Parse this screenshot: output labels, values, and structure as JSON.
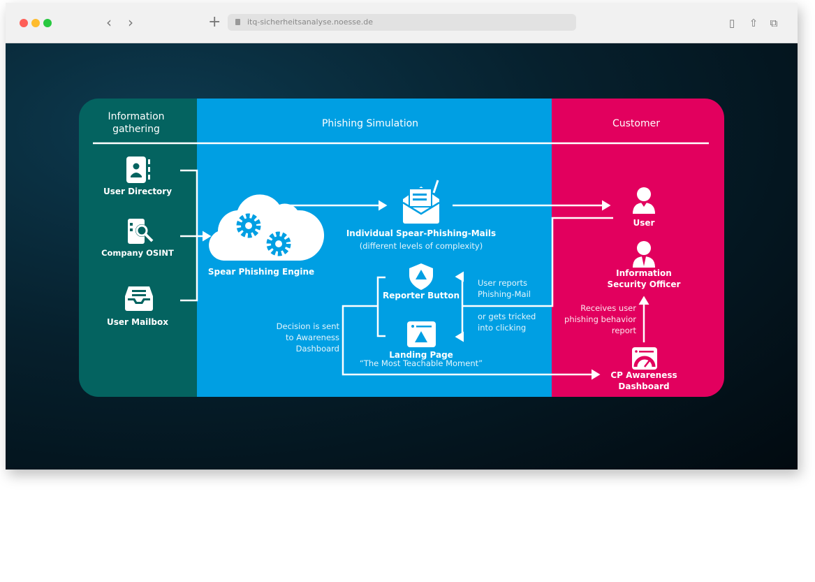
{
  "browser": {
    "url": "itq-sicherheitsanalyse.noesse.de",
    "controls": [
      "close",
      "minimize",
      "zoom"
    ],
    "icons": [
      "back-icon",
      "forward-icon",
      "new-tab-icon",
      "lock-icon",
      "reader-icon",
      "share-icon",
      "tabs-icon"
    ]
  },
  "colors": {
    "gathering": "#046360",
    "simulation": "#009fe3",
    "customer": "#e2005e"
  },
  "diagram": {
    "columns": {
      "gathering": "Information\ngathering",
      "gathering_l1": "Information",
      "gathering_l2": "gathering",
      "simulation": "Phishing Simulation",
      "customer": "Customer"
    },
    "sources": {
      "user_directory": "User Directory",
      "company_osint": "Company OSINT",
      "user_mailbox": "User Mailbox"
    },
    "engine": "Spear Phishing Engine",
    "mails": {
      "title": "Individual Spear-Phishing-Mails",
      "subtitle": "(different levels of complexity)"
    },
    "reporter": "Reporter Button",
    "landing": {
      "title": "Landing Page",
      "subtitle": "“The Most Teachable Moment”"
    },
    "user_reports": [
      "User reports",
      "Phishing-Mail"
    ],
    "tricked": [
      "or gets tricked",
      "into clicking"
    ],
    "decision": [
      "Decision is sent",
      "to Awareness",
      "Dashboard"
    ],
    "user": "User",
    "iso": [
      "Information",
      "Security Officer"
    ],
    "receives": [
      "Receives user",
      "phishing behavior",
      "report"
    ],
    "dashboard": [
      "CP Awareness",
      "Dashboard"
    ]
  }
}
